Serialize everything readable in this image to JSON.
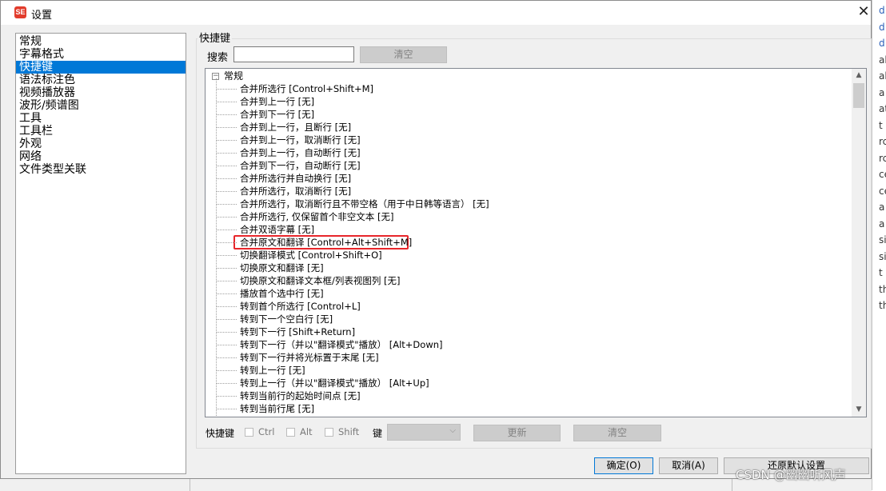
{
  "window": {
    "title": "设置",
    "app_icon": "SE"
  },
  "categories": [
    "常规",
    "字幕格式",
    "快捷键",
    "语法标注色",
    "视频播放器",
    "波形/频谱图",
    "工具",
    "工具栏",
    "外观",
    "网络",
    "文件类型关联"
  ],
  "selected_category": "快捷键",
  "group": {
    "label": "快捷键"
  },
  "search": {
    "label": "搜索",
    "value": "",
    "clear_label": "清空"
  },
  "tree": {
    "root": "常规",
    "items": [
      "合并所选行 [Control+Shift+M]",
      "合并到上一行 [无]",
      "合并到下一行 [无]",
      "合并到上一行，且断行 [无]",
      "合并到上一行，取消断行 [无]",
      "合并到上一行，自动断行 [无]",
      "合并到下一行，自动断行 [无]",
      "合并所选行并自动换行 [无]",
      "合并所选行，取消断行 [无]",
      "合并所选行，取消断行且不带空格（用于中日韩等语言） [无]",
      "合并所选行, 仅保留首个非空文本 [无]",
      "合并双语字幕 [无]",
      "合并原文和翻译 [Control+Alt+Shift+M]",
      "切换翻译模式 [Control+Shift+O]",
      "切换原文和翻译 [无]",
      "切换原文和翻译文本框/列表视图列 [无]",
      "播放首个选中行 [无]",
      "转到首个所选行 [Control+L]",
      "转到下一个空白行 [无]",
      "转到下一行 [Shift+Return]",
      "转到下一行（并以\"翻译模式\"播放） [Alt+Down]",
      "转到下一行并将光标置于末尾 [无]",
      "转到上一行 [无]",
      "转到上一行（并以\"翻译模式\"播放） [Alt+Up]",
      "转到当前行的起始时间点 [无]",
      "转到当前行尾 [无]"
    ]
  },
  "shortcut": {
    "label": "快捷键",
    "ctrl": "Ctrl",
    "alt": "Alt",
    "shift": "Shift",
    "key_label": "键",
    "key_value": "",
    "update_label": "更新",
    "clear_label": "清空"
  },
  "buttons": {
    "ok": "确定(O)",
    "cancel": "取消(A)",
    "restore": "还原默认设置"
  },
  "watermark": "CSDN @幽幽听风声",
  "background_fragments": [
    "d",
    "d",
    "d",
    "al",
    "al",
    "a",
    "at",
    "t",
    "rc",
    "rc",
    "ce",
    "ce",
    "a",
    "a",
    "si",
    "si",
    "t",
    "th",
    "th"
  ],
  "colors": {
    "selection": "#0078d7",
    "highlight": "#e8262b",
    "app_icon": "#e23c2c"
  }
}
